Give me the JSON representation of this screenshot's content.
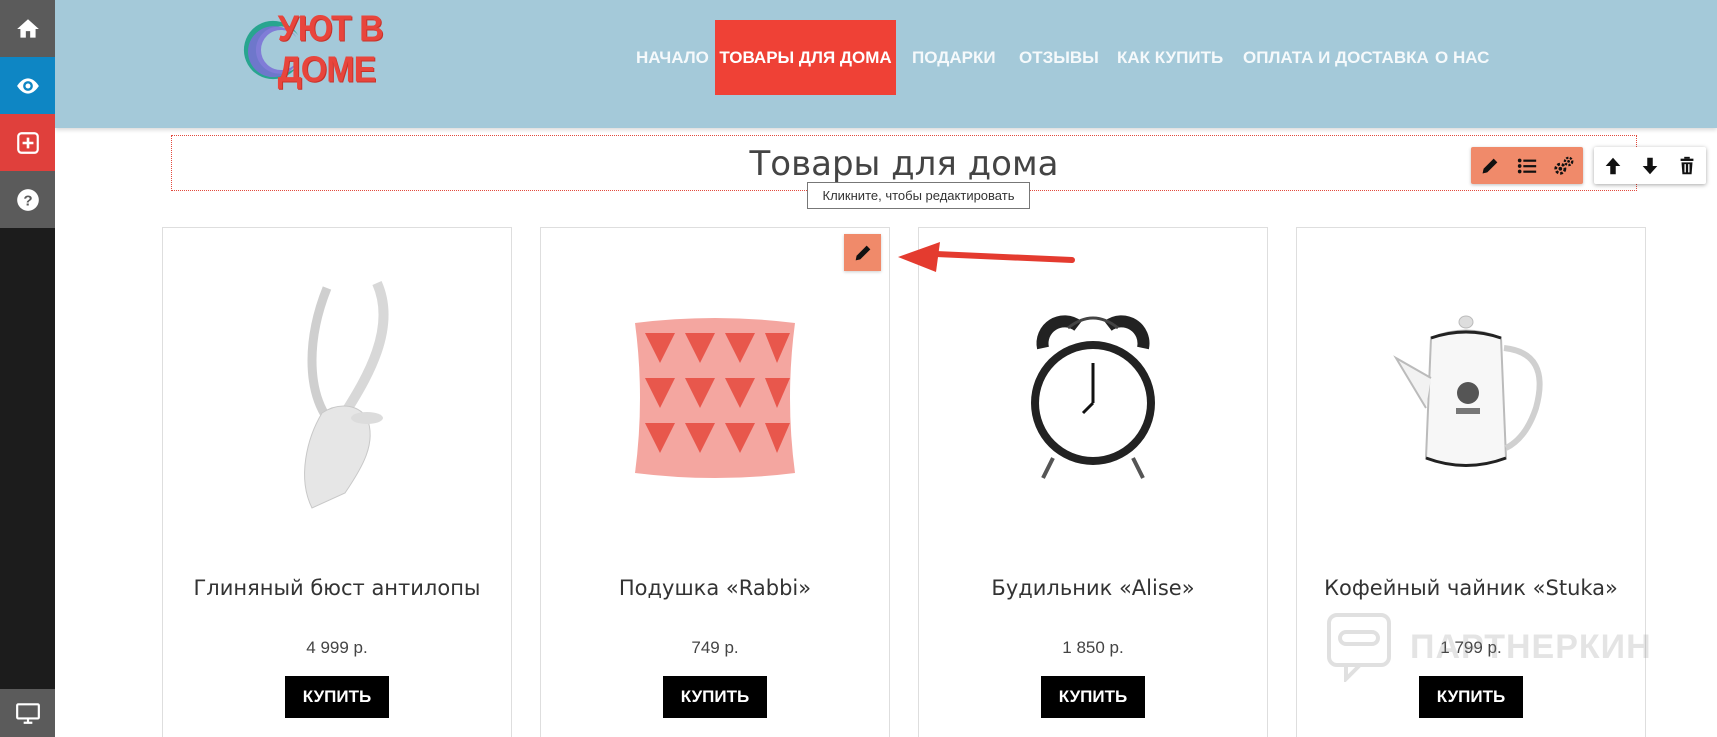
{
  "sidebar": {
    "items": [
      {
        "icon": "home-icon"
      },
      {
        "icon": "eye-icon"
      },
      {
        "icon": "add-block-icon"
      },
      {
        "icon": "help-icon"
      },
      {
        "icon": "desktop-icon"
      }
    ]
  },
  "header": {
    "logo_text": "УЮТ В ДОМЕ",
    "nav": [
      {
        "label": "НАЧАЛО"
      },
      {
        "label": "ТОВАРЫ ДЛЯ ДОМА",
        "active": true
      },
      {
        "label": "ПОДАРКИ"
      },
      {
        "label": "ОТЗЫВЫ"
      },
      {
        "label": "КАК КУПИТЬ"
      },
      {
        "label": "ОПЛАТА И ДОСТАВКА"
      },
      {
        "label": "О НАС"
      }
    ]
  },
  "section": {
    "title": "Товары для дома",
    "tooltip": "Кликните, чтобы редактировать"
  },
  "toolbar": {
    "edit_tools": [
      "pencil-icon",
      "list-icon",
      "settings-icon"
    ],
    "move_tools": [
      "arrow-up-icon",
      "arrow-down-icon",
      "trash-icon"
    ]
  },
  "products": [
    {
      "name": "Глиняный бюст антилопы",
      "price": "4 999 р.",
      "button": "КУПИТЬ",
      "image": "antelope-bust"
    },
    {
      "name": "Подушка «Rabbi»",
      "price": "749 р.",
      "button": "КУПИТЬ",
      "image": "pillow"
    },
    {
      "name": "Будильник «Alise»",
      "price": "1 850 р.",
      "button": "КУПИТЬ",
      "image": "alarm-clock"
    },
    {
      "name": "Кофейный чайник «Stuka»",
      "price": "1 799 р.",
      "button": "КУПИТЬ",
      "image": "coffee-pot"
    }
  ],
  "watermark": "ПАРТНЕРКИН",
  "colors": {
    "header_bg": "#a4c9d9",
    "accent": "#ef4136",
    "tool_orange": "#f08a6a",
    "sidebar_bg": "#1c1c1c"
  }
}
